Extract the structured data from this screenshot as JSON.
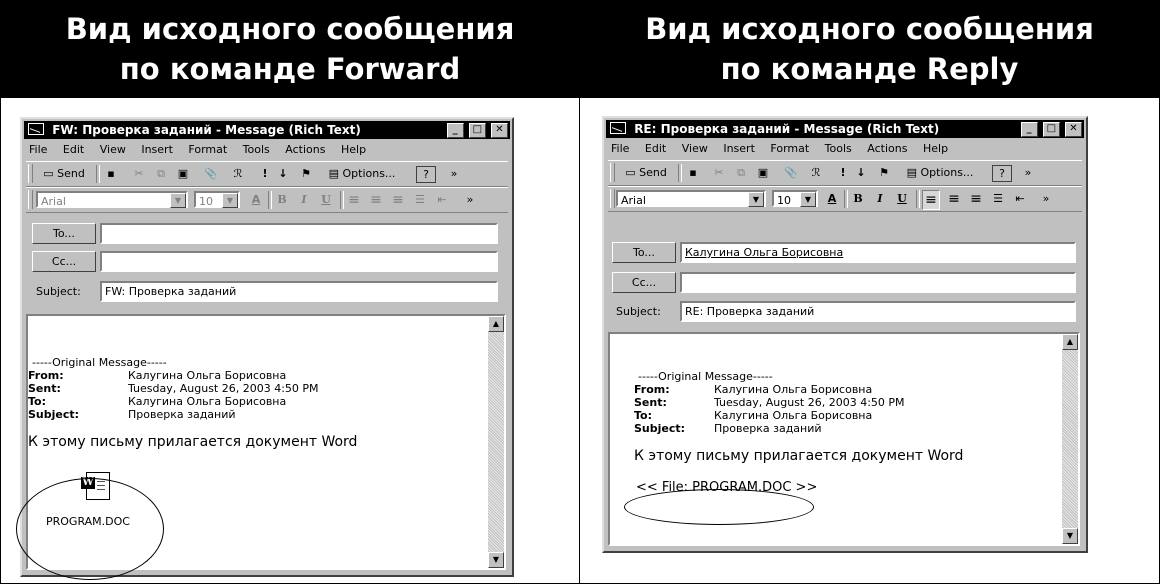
{
  "left": {
    "heading_line1": "Вид исходного сообщения",
    "heading_line2": "по команде Forward",
    "window": {
      "title": "FW: Проверка заданий - Message (Rich Text)",
      "to_value": "",
      "cc_value": "",
      "subject_value": "FW: Проверка заданий"
    },
    "attachment_name": "PROGRAM.DOC"
  },
  "right": {
    "heading_line1": "Вид исходного сообщения",
    "heading_line2": "по команде Reply",
    "window": {
      "title": "RE: Проверка заданий - Message (Rich Text)",
      "to_value": "Калугина Ольга Борисовна",
      "cc_value": "",
      "subject_value": "RE: Проверка заданий"
    },
    "attachment_ref": "<< File: PROGRAM.DOC >>"
  },
  "menu": [
    "File",
    "Edit",
    "View",
    "Insert",
    "Format",
    "Tools",
    "Actions",
    "Help"
  ],
  "toolbar": {
    "send": "Send",
    "options": "Options...",
    "font": "Arial",
    "size": "10",
    "help_icon": "?",
    "more": "»"
  },
  "labels": {
    "to_button": "To...",
    "cc_button": "Cc...",
    "subject": "Subject:"
  },
  "original": {
    "separator": "-----Original Message-----",
    "from_label": "From:",
    "from_value": "Калугина Ольга Борисовна",
    "sent_label": "Sent:",
    "sent_value": "Tuesday, August 26, 2003 4:50 PM",
    "to_label": "To:",
    "to_value": "Калугина Ольга Борисовна",
    "subject_label": "Subject:",
    "subject_value": "Проверка заданий",
    "body": "К этому письму прилагается документ Word"
  },
  "icons": {
    "window_icon": "envelope-icon",
    "attachment_icon": "word-document-icon"
  },
  "window_buttons": {
    "minimize": "_",
    "maximize": "□",
    "close": "✕"
  },
  "toolbar_glyphs": {
    "save": "▪",
    "cut": "✂",
    "copy": "⧉",
    "paste": "▣",
    "attach": "📎",
    "check_names": "ℛ",
    "importance_high": "!",
    "importance_low": "↓",
    "flag": "⚑",
    "font_color": "A",
    "bold": "B",
    "italic": "I",
    "underline": "U",
    "align_left": "≡",
    "center": "≡",
    "align_right": "≡",
    "bullets": "☰",
    "decrease_indent": "⇤"
  }
}
